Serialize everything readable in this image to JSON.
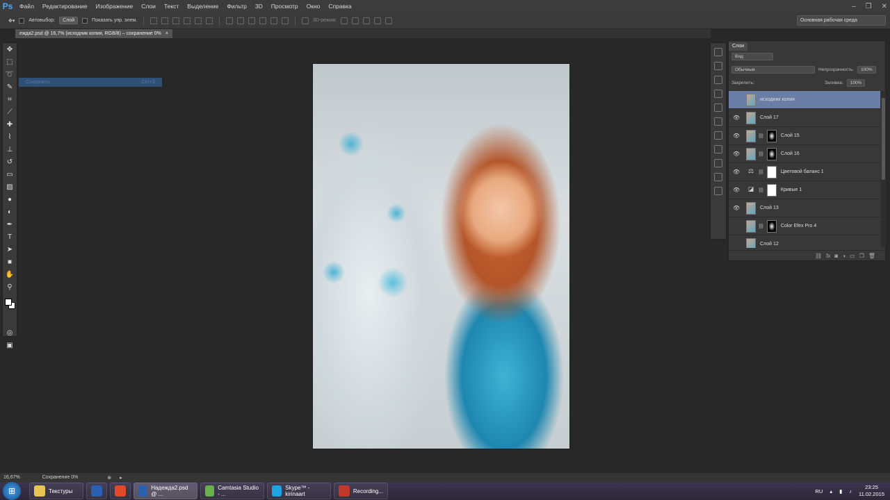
{
  "app": {
    "logo": "Ps"
  },
  "menu": [
    "Файл",
    "Редактирование",
    "Изображение",
    "Слои",
    "Текст",
    "Выделение",
    "Фильтр",
    "3D",
    "Просмотр",
    "Окно",
    "Справка"
  ],
  "options": {
    "autoselect_label": "Автовыбор:",
    "autoselect_value": "Слой",
    "show_controls_label": "Показать упр. элем.",
    "mode_3d_label": "3D-режим:",
    "workspace": "Основная рабочая среда"
  },
  "document": {
    "tab_title": "ежда2.psd @ 16,7% (исходник копия, RGB/8) – сохранение 0%",
    "close": "×"
  },
  "context_menu": {
    "item": "Сохранить",
    "shortcut": "Ctrl+S"
  },
  "layers_panel": {
    "title": "Слои",
    "filter_kind": "Вид",
    "blend_mode": "Обычные",
    "opacity_label": "Непрозрачность:",
    "opacity_value": "100%",
    "lock_label": "Закрепить:",
    "fill_label": "Заливка:",
    "fill_value": "100%",
    "layers": [
      {
        "name": "исходник копия",
        "selected": true,
        "visible": false,
        "type": "image"
      },
      {
        "name": "Слой 17",
        "visible": true,
        "type": "image"
      },
      {
        "name": "Слой 15",
        "visible": true,
        "type": "image-mask"
      },
      {
        "name": "Слой 16",
        "visible": true,
        "type": "image-mask"
      },
      {
        "name": "Цветовой баланс 1",
        "visible": true,
        "type": "adjust-balance"
      },
      {
        "name": "Кривые 1",
        "visible": true,
        "type": "adjust-curves"
      },
      {
        "name": "Слой 13",
        "visible": true,
        "type": "image"
      },
      {
        "name": "Color Efex Pro 4",
        "visible": false,
        "type": "image-mask"
      },
      {
        "name": "Слой 12",
        "visible": false,
        "type": "image"
      }
    ]
  },
  "status": {
    "zoom": "16,67%",
    "message": "Сохранение 0%"
  },
  "taskbar": {
    "apps": [
      {
        "label": "Текстуры",
        "color": "#e8c550"
      },
      {
        "label": "",
        "color": "#2b5fb0"
      },
      {
        "label": "",
        "color": "#e04a2a"
      },
      {
        "label": "Надежда2.psd @ ...",
        "color": "#2b5fb0",
        "active": true
      },
      {
        "label": "Camtasia Studio - ...",
        "color": "#6ab04c"
      },
      {
        "label": "Skype™ - kirinaart",
        "color": "#1ea5e0"
      },
      {
        "label": "Recording...",
        "color": "#c0392b"
      }
    ],
    "lang": "RU",
    "time": "23:25",
    "date": "11.02.2015"
  }
}
